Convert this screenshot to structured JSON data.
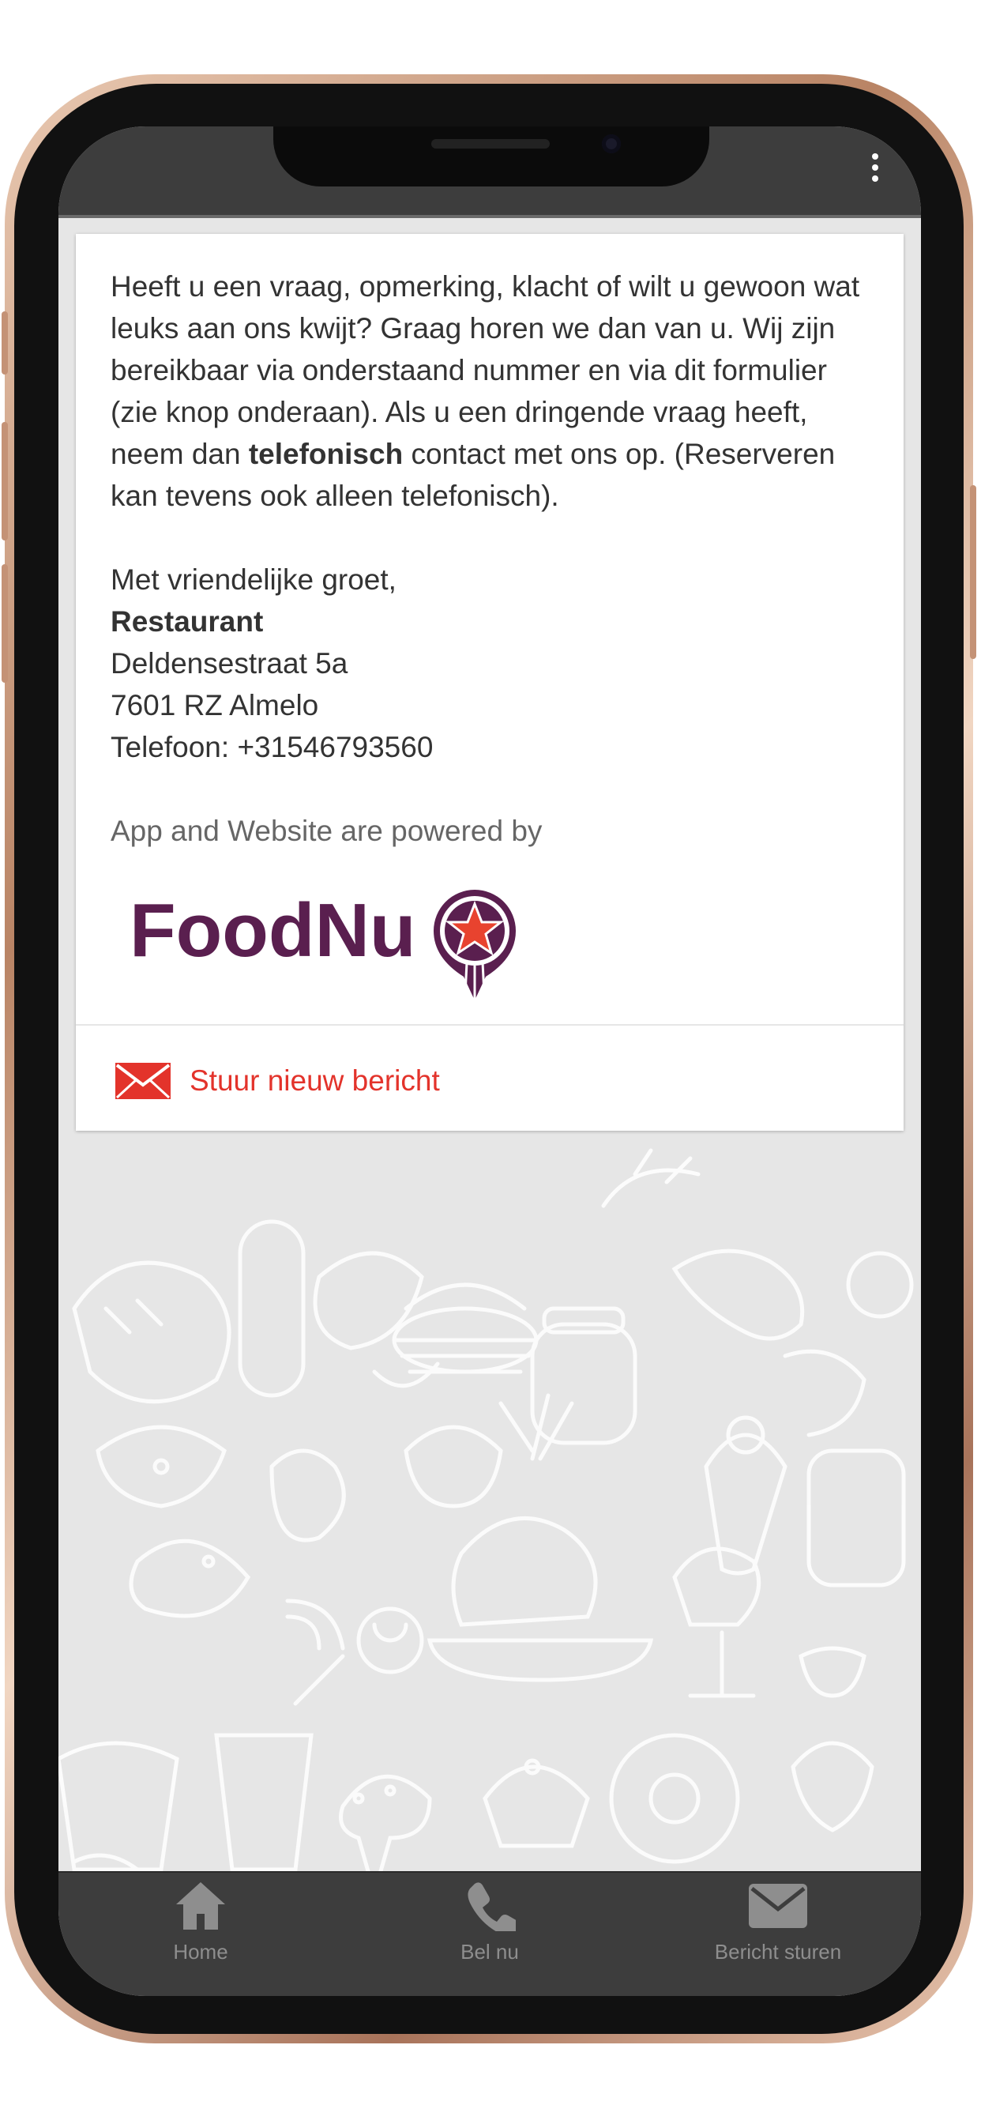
{
  "header": {
    "menu_icon": "more-vert-icon"
  },
  "card": {
    "intro_part1": "Heeft u een vraag, opmerking, klacht of wilt u gewoon wat leuks aan ons kwijt? Graag horen we dan van u. Wij zijn bereikbaar via onderstaand nummer en via dit formulier (zie knop onderaan). Als u een dringende vraag heeft, neem dan ",
    "intro_bold": "telefonisch",
    "intro_part2": " contact met ons op. (Reserveren kan tevens ook alleen telefonisch).",
    "greeting": "Met vriendelijke groet,",
    "restaurant_name": "Restaurant",
    "address_street": "Deldensestraat 5a",
    "address_city": "7601 RZ Almelo",
    "phone": "Telefoon: +31546793560",
    "powered_by": "App and Website are powered by",
    "logo_text": "FoodNu",
    "new_message_label": "Stuur nieuw bericht"
  },
  "tabbar": {
    "items": [
      {
        "label": "Home",
        "icon": "home-icon"
      },
      {
        "label": "Bel nu",
        "icon": "phone-icon"
      },
      {
        "label": "Bericht sturen",
        "icon": "mail-icon"
      }
    ]
  },
  "colors": {
    "accent": "#e3332b",
    "logo_purple": "#5a1f4f",
    "bar_bg": "#3d3d3d",
    "tab_icon": "#8e8e8e"
  }
}
